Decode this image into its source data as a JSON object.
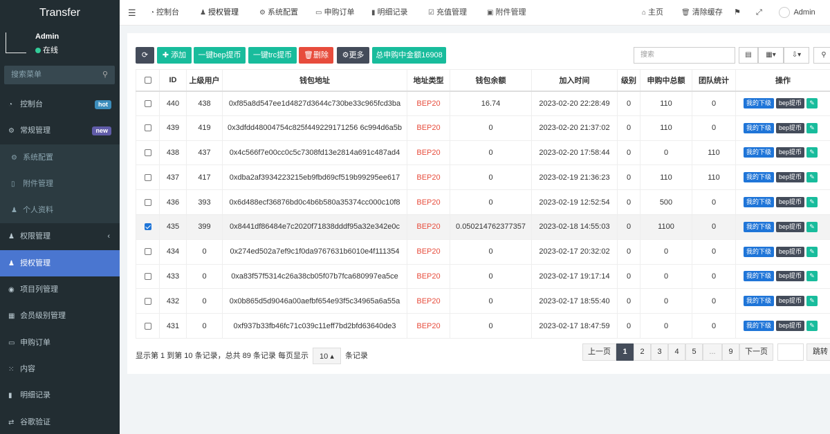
{
  "app": {
    "brand": "Transfer"
  },
  "user": {
    "name": "Admin",
    "status": "在线"
  },
  "sidebar": {
    "search_placeholder": "搜索菜单",
    "items": [
      {
        "label": "控制台",
        "icon": "dashboard-icon",
        "badge": "hot"
      },
      {
        "label": "常规管理",
        "icon": "cogs-icon",
        "badge": "new"
      },
      {
        "label": "系统配置",
        "icon": "gear-icon",
        "sub": true
      },
      {
        "label": "附件管理",
        "icon": "file-icon",
        "sub": true
      },
      {
        "label": "个人资料",
        "icon": "user-icon",
        "sub": true
      },
      {
        "label": "权限管理",
        "icon": "group-icon",
        "chevron": "‹"
      },
      {
        "label": "授权管理",
        "icon": "group-icon",
        "active": true
      },
      {
        "label": "项目列管理",
        "icon": "compass-icon"
      },
      {
        "label": "会员级别管理",
        "icon": "calendar-icon"
      },
      {
        "label": "申购订单",
        "icon": "card-icon"
      },
      {
        "label": "内容",
        "icon": "grid-icon"
      },
      {
        "label": "明细记录",
        "icon": "bar-chart-icon"
      },
      {
        "label": "谷歌验证",
        "icon": "exchange-icon"
      }
    ]
  },
  "topnav": {
    "tabs": [
      {
        "label": "控制台",
        "icon": "dashboard-icon"
      },
      {
        "label": "授权管理",
        "icon": "group-icon",
        "active": true
      },
      {
        "label": "系统配置",
        "icon": "gear-icon"
      },
      {
        "label": "申购订单",
        "icon": "card-icon"
      },
      {
        "label": "明细记录",
        "icon": "bar-chart-icon"
      },
      {
        "label": "充值管理",
        "icon": "calendar-check-icon"
      },
      {
        "label": "附件管理",
        "icon": "file-image-icon"
      }
    ],
    "home": "主页",
    "clear_cache": "清除缓存",
    "admin": "Admin"
  },
  "toolbar": {
    "add": "添加",
    "bep": "一键bep提币",
    "trc": "一键trc提币",
    "delete": "删除",
    "more": "更多",
    "total": "总申购中金额16908",
    "search_placeholder": "搜索"
  },
  "table": {
    "headers": [
      "ID",
      "上级用户",
      "钱包地址",
      "地址类型",
      "钱包余额",
      "加入时间",
      "级别",
      "申购中总额",
      "团队统计",
      "操作"
    ],
    "rows": [
      {
        "id": "440",
        "parent": "438",
        "addr": "0xf85a8d547ee1d4827d3644c730be33c965fcd3ba",
        "type": "BEP20",
        "balance": "16.74",
        "time": "2023-02-20 22:28:49",
        "level": "0",
        "sub": "110",
        "team": "0",
        "checked": false
      },
      {
        "id": "439",
        "parent": "419",
        "addr": "0x3dfdd48004754c825f449229171256 6c994d6a5b",
        "type": "BEP20",
        "balance": "0",
        "time": "2023-02-20 21:37:02",
        "level": "0",
        "sub": "110",
        "team": "0",
        "checked": false
      },
      {
        "id": "438",
        "parent": "437",
        "addr": "0x4c566f7e00cc0c5c7308fd13e2814a691c487ad4",
        "type": "BEP20",
        "balance": "0",
        "time": "2023-02-20 17:58:44",
        "level": "0",
        "sub": "0",
        "team": "110",
        "checked": false
      },
      {
        "id": "437",
        "parent": "417",
        "addr": "0xdba2af3934223215eb9fbd69cf519b99295ee617",
        "type": "BEP20",
        "balance": "0",
        "time": "2023-02-19 21:36:23",
        "level": "0",
        "sub": "110",
        "team": "110",
        "checked": false
      },
      {
        "id": "436",
        "parent": "393",
        "addr": "0x6d488ecf36876bd0c4b6b580a35374cc000c10f8",
        "type": "BEP20",
        "balance": "0",
        "time": "2023-02-19 12:52:54",
        "level": "0",
        "sub": "500",
        "team": "0",
        "checked": false
      },
      {
        "id": "435",
        "parent": "399",
        "addr": "0x8441df86484e7c2020f71838dddf95a32e342e0c",
        "type": "BEP20",
        "balance": "0.050214762377357",
        "time": "2023-02-18 14:55:03",
        "level": "0",
        "sub": "1100",
        "team": "0",
        "checked": true
      },
      {
        "id": "434",
        "parent": "0",
        "addr": "0x274ed502a7ef9c1f0da9767631b6010e4f111354",
        "type": "BEP20",
        "balance": "0",
        "time": "2023-02-17 20:32:02",
        "level": "0",
        "sub": "0",
        "team": "0",
        "checked": false
      },
      {
        "id": "433",
        "parent": "0",
        "addr": "0xa83f57f5314c26a38cb05f07b7fca680997ea5ce",
        "type": "BEP20",
        "balance": "0",
        "time": "2023-02-17 19:17:14",
        "level": "0",
        "sub": "0",
        "team": "0",
        "checked": false
      },
      {
        "id": "432",
        "parent": "0",
        "addr": "0x0b865d5d9046a00aefbf654e93f5c34965a6a55a",
        "type": "BEP20",
        "balance": "0",
        "time": "2023-02-17 18:55:40",
        "level": "0",
        "sub": "0",
        "team": "0",
        "checked": false
      },
      {
        "id": "431",
        "parent": "0",
        "addr": "0xf937b33fb46fc71c039c11eff7bd2bfd63640de3",
        "type": "BEP20",
        "balance": "0",
        "time": "2023-02-17 18:47:59",
        "level": "0",
        "sub": "0",
        "team": "0",
        "checked": false
      }
    ],
    "op_sub": "我的下级",
    "op_bep": "bep提币"
  },
  "footer": {
    "info_prefix": "显示第 1 到第 10 条记录，总共 89 条记录 每页显示",
    "page_size": "10",
    "info_suffix": "条记录",
    "prev": "上一页",
    "next": "下一页",
    "pages": [
      "1",
      "2",
      "3",
      "4",
      "5",
      "...",
      "9"
    ],
    "jump": "跳转"
  }
}
